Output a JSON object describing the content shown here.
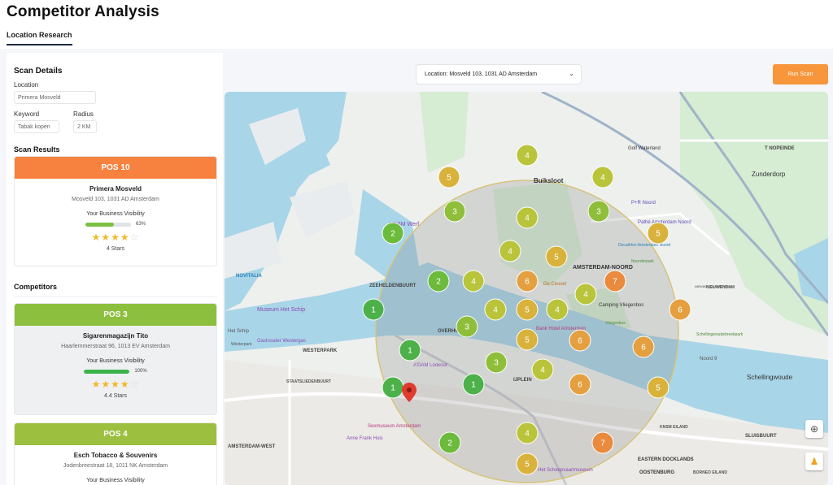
{
  "header": {
    "title": "Competitor Analysis",
    "tab": "Location Research"
  },
  "scan_details": {
    "title": "Scan Details",
    "location_label": "Location",
    "location_value": "Primera Mosveld",
    "keyword_label": "Keyword",
    "keyword_value": "Tabak kopen",
    "radius_label": "Radius",
    "radius_value": "2 KM"
  },
  "scan_results": {
    "title": "Scan Results",
    "card": {
      "pos": "POS 10",
      "name": "Primera Mosveld",
      "address": "Mosveld 103, 1031 AD Amsterdam",
      "visibility_label": "Your Business Visibility",
      "visibility_pct": "63%",
      "visibility": 0.63,
      "stars": 4,
      "stars_text": "4 Stars",
      "head_color": "#f7813f",
      "bar_color": "#7bc043"
    }
  },
  "competitors": {
    "title": "Competitors",
    "cards": [
      {
        "pos": "POS 3",
        "name": "Sigarenmagazijn Tito",
        "address": "Haarlemmerstraat 96, 1013 EV Amsterdam",
        "visibility_label": "Your Business Visibility",
        "visibility_pct": "100%",
        "visibility": 1.0,
        "stars": 4.4,
        "stars_text": "4.4 Stars",
        "head_color": "#8dbf3f",
        "bar_color": "#3cb44b"
      },
      {
        "pos": "POS 4",
        "name": "Esch Tobacco & Souvenirs",
        "address": "Jodenbreestraat 18, 1011 NK Amsterdam",
        "visibility_label": "Your Business Visibility",
        "head_color": "#9cbf3f"
      }
    ]
  },
  "toolbar": {
    "location_dropdown": "Location: Mosveld 103, 1031 AD Amsterdam",
    "run_scan": "Run Scan"
  },
  "map": {
    "labels": [
      "Buiksloot",
      "AMSTERDAM-NOORD",
      "ZEEHELDENBUURT",
      "WESTERPARK",
      "STAATSLIEDENBUURT",
      "AMSTERDAM-WEST",
      "OVERHOEK",
      "IJPLEIN",
      "Zunderdorp",
      "Schellingwoude",
      "NIEUWENDAM",
      "EASTERN DOCKLANDS",
      "OOSTENBURG",
      "SLUISBUURT",
      "KNSM EILAND",
      "BORNEO EILAND",
      "NOVITALIA",
      "Museum Het Schip",
      "Gashouder Westergas",
      "Golf Waterland",
      "P+R Noord",
      "Pathé Amsterdam Noord",
      "Decathlon Amsterdam Noord",
      "Camping Vliegenbos",
      "Vliegenbos",
      "Bank Hotel Amsterdam",
      "A'DAM Lookout",
      "Sexmuseum Amsterdam",
      "Anne Frank Huis",
      "Het Scheepvaartmuseum",
      "Schellingwoudebreekpark",
      "Noorderpark",
      "De Ceuvel",
      "NDSM Werf",
      "T NOPEINDE",
      "NIEUWENDAMMERHAM",
      "Het Schip",
      "Westerpark",
      "Noord 9"
    ],
    "markers": [
      {
        "n": 5,
        "c": "#d9b23c"
      },
      {
        "n": 4,
        "c": "#b9c43a"
      },
      {
        "n": 4,
        "c": "#b9c43a"
      },
      {
        "n": 3,
        "c": "#8fbe3a"
      },
      {
        "n": 4,
        "c": "#b9c43a"
      },
      {
        "n": 3,
        "c": "#8fbe3a"
      },
      {
        "n": 5,
        "c": "#d9b23c"
      },
      {
        "n": 2,
        "c": "#6cbb3c"
      },
      {
        "n": 4,
        "c": "#b9c43a"
      },
      {
        "n": 5,
        "c": "#d9b23c"
      },
      {
        "n": 2,
        "c": "#6cbb3c"
      },
      {
        "n": 4,
        "c": "#b9c43a"
      },
      {
        "n": 6,
        "c": "#e4a040"
      },
      {
        "n": 4,
        "c": "#b9c43a"
      },
      {
        "n": 7,
        "c": "#e98a3d"
      },
      {
        "n": 1,
        "c": "#4db14a"
      },
      {
        "n": 4,
        "c": "#b9c43a"
      },
      {
        "n": 5,
        "c": "#d9b23c"
      },
      {
        "n": 4,
        "c": "#b9c43a"
      },
      {
        "n": 6,
        "c": "#e4a040"
      },
      {
        "n": 3,
        "c": "#8fbe3a"
      },
      {
        "n": 5,
        "c": "#d9b23c"
      },
      {
        "n": 6,
        "c": "#e4a040"
      },
      {
        "n": 1,
        "c": "#4db14a"
      },
      {
        "n": 6,
        "c": "#e4a040"
      },
      {
        "n": 3,
        "c": "#8fbe3a"
      },
      {
        "n": 4,
        "c": "#b9c43a"
      },
      {
        "n": 1,
        "c": "#4db14a"
      },
      {
        "n": 1,
        "c": "#4db14a"
      },
      {
        "n": 6,
        "c": "#e4a040"
      },
      {
        "n": 5,
        "c": "#d9b23c"
      },
      {
        "n": 2,
        "c": "#6cbb3c"
      },
      {
        "n": 4,
        "c": "#b9c43a"
      },
      {
        "n": 7,
        "c": "#e98a3d"
      },
      {
        "n": 5,
        "c": "#d9b23c"
      }
    ]
  }
}
